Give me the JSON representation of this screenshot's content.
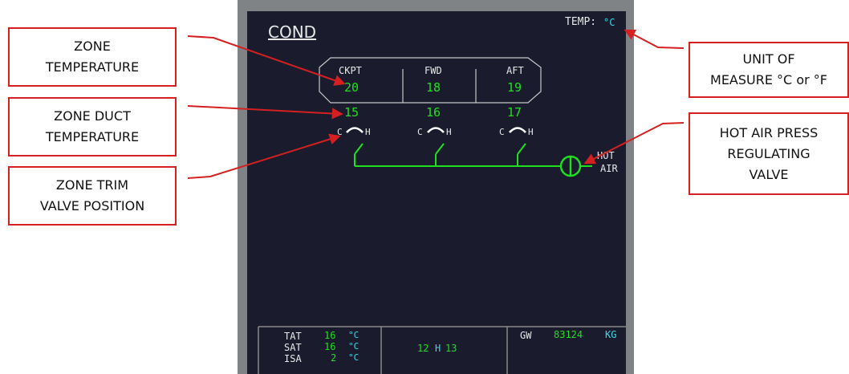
{
  "callouts": {
    "zone_temperature": [
      "ZONE",
      "TEMPERATURE"
    ],
    "zone_duct_temperature": [
      "ZONE DUCT",
      "TEMPERATURE"
    ],
    "zone_trim_valve_position": [
      "ZONE TRIM",
      "VALVE POSITION"
    ],
    "unit_of_measure": [
      "UNIT OF",
      "MEASURE °C or °F"
    ],
    "hot_air_press_valve": [
      "HOT AIR PRESS",
      "REGULATING",
      "VALVE"
    ]
  },
  "display": {
    "page_title": "COND",
    "temp_unit_label": "TEMP:",
    "temp_unit_value": "°C",
    "zones": [
      {
        "name": "CKPT",
        "zone_temp": "20",
        "duct_temp": "15"
      },
      {
        "name": "FWD",
        "zone_temp": "18",
        "duct_temp": "16"
      },
      {
        "name": "AFT",
        "zone_temp": "19",
        "duct_temp": "17"
      }
    ],
    "valve_cold_label": "C",
    "valve_hot_label": "H",
    "hot_air_label": [
      "HOT",
      "AIR"
    ],
    "status": {
      "tat_label": "TAT",
      "tat_value": "16",
      "tat_unit": "°C",
      "sat_label": "SAT",
      "sat_value": "16",
      "sat_unit": "°C",
      "isa_label": "ISA",
      "isa_value": "2",
      "isa_unit": "°C",
      "time_h": "12",
      "time_sep": "H",
      "time_m": "13",
      "gw_label": "GW",
      "gw_value": "83124",
      "gw_unit": "KG"
    }
  },
  "colors": {
    "annotation_red": "#d42020",
    "ecam_green": "#1fe01f",
    "ecam_cyan": "#39d8e8",
    "ecam_white": "#e8e8e8",
    "display_background": "#1a1c2d"
  }
}
